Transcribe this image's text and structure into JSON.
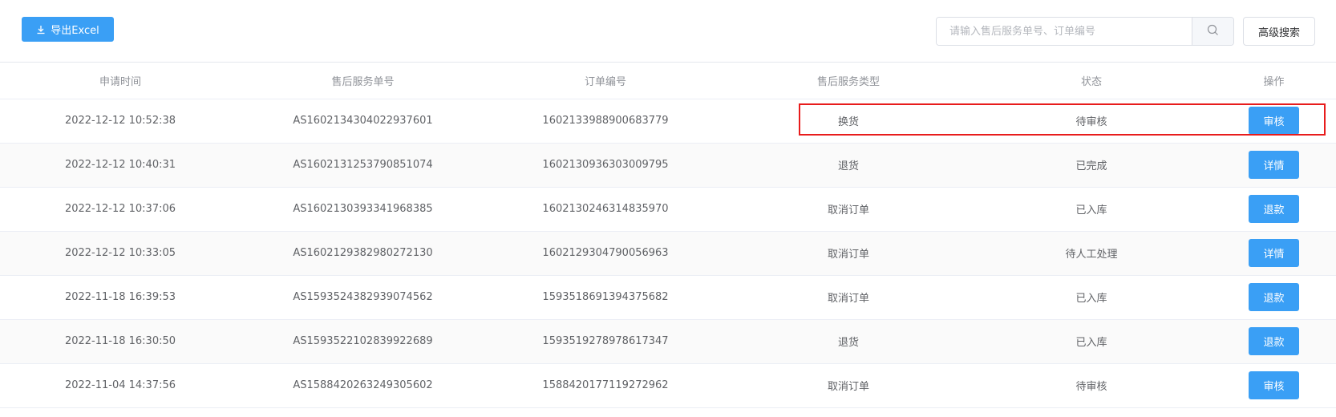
{
  "toolbar": {
    "export_label": "导出Excel",
    "search_placeholder": "请输入售后服务单号、订单编号",
    "search_value": "",
    "advanced_search_label": "高级搜索"
  },
  "table": {
    "columns": [
      "申请时间",
      "售后服务单号",
      "订单编号",
      "售后服务类型",
      "状态",
      "操作"
    ],
    "rows": [
      {
        "time": "2022-12-12 10:52:38",
        "service_no": "AS1602134304022937601",
        "order_no": "1602133988900683779",
        "type": "换货",
        "status": "待审核",
        "action": "审核"
      },
      {
        "time": "2022-12-12 10:40:31",
        "service_no": "AS1602131253790851074",
        "order_no": "1602130936303009795",
        "type": "退货",
        "status": "已完成",
        "action": "详情"
      },
      {
        "time": "2022-12-12 10:37:06",
        "service_no": "AS1602130393341968385",
        "order_no": "1602130246314835970",
        "type": "取消订单",
        "status": "已入库",
        "action": "退款"
      },
      {
        "time": "2022-12-12 10:33:05",
        "service_no": "AS1602129382980272130",
        "order_no": "1602129304790056963",
        "type": "取消订单",
        "status": "待人工处理",
        "action": "详情"
      },
      {
        "time": "2022-11-18 16:39:53",
        "service_no": "AS1593524382939074562",
        "order_no": "1593518691394375682",
        "type": "取消订单",
        "status": "已入库",
        "action": "退款"
      },
      {
        "time": "2022-11-18 16:30:50",
        "service_no": "AS1593522102839922689",
        "order_no": "1593519278978617347",
        "type": "退货",
        "status": "已入库",
        "action": "退款"
      },
      {
        "time": "2022-11-04 14:37:56",
        "service_no": "AS1588420263249305602",
        "order_no": "1588420177119272962",
        "type": "取消订单",
        "status": "待审核",
        "action": "审核"
      }
    ]
  },
  "icons": {
    "export": "download-icon",
    "search": "search-icon"
  },
  "colors": {
    "primary": "#3a9ff5",
    "highlight": "#e81c1c"
  }
}
